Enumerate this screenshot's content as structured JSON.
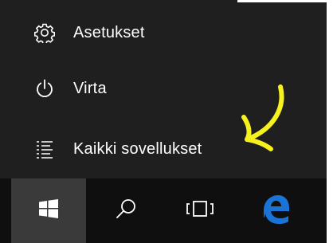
{
  "menu": {
    "items": [
      {
        "label": "Asetukset",
        "icon": "gear-icon"
      },
      {
        "label": "Virta",
        "icon": "power-icon"
      },
      {
        "label": "Kaikki sovellukset",
        "icon": "all-apps-list-icon"
      }
    ]
  },
  "taskbar": {
    "buttons": [
      {
        "icon": "windows-logo-icon"
      },
      {
        "icon": "search-icon"
      },
      {
        "icon": "task-view-icon"
      },
      {
        "icon": "edge-browser-icon"
      }
    ]
  },
  "colors": {
    "menu_background": "#1f1f1f",
    "taskbar_background": "#0f0f0f",
    "start_button_active": "#3a3a3a",
    "text": "#ffffff",
    "edge_blue": "#1a73d6",
    "annotation": "#f7f21e"
  }
}
